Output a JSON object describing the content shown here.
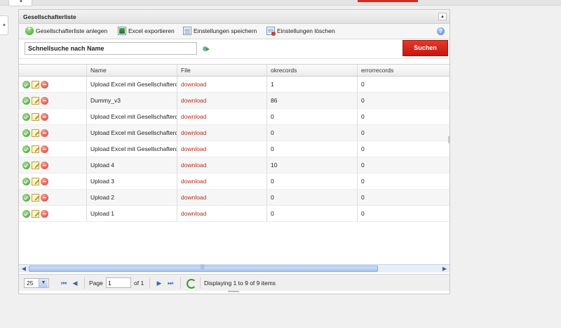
{
  "top": {
    "tab_icon": "plus-icon",
    "left_tab_icon": "plus-icon"
  },
  "panel": {
    "title": "Gesellschafterliste",
    "collapse_glyph": "▲"
  },
  "toolbar": {
    "add_label": "Gesellschafterliste anlegen",
    "export_label": "Excel exportieren",
    "save_label": "Einstellungen speichern",
    "delete_label": "Einstellungen löschen",
    "help_glyph": "?"
  },
  "search": {
    "value": "Schnellsuche nach Name",
    "button_label": "Suchen"
  },
  "grid": {
    "columns": [
      "",
      "Name",
      "File",
      "okrecords",
      "errorrecords"
    ],
    "rows": [
      {
        "name": "Upload Excel mit Gesellschafterdaten",
        "file": "download",
        "ok": "1",
        "err": "0"
      },
      {
        "name": "Dummy_v3",
        "file": "download",
        "ok": "86",
        "err": "0"
      },
      {
        "name": "Upload Excel mit Gesellschafterdaten",
        "file": "download",
        "ok": "0",
        "err": "0"
      },
      {
        "name": "Upload Excel mit Gesellschafterdaten",
        "file": "download",
        "ok": "0",
        "err": "0"
      },
      {
        "name": "Upload Excel mit Gesellschafterdaten",
        "file": "download",
        "ok": "0",
        "err": "0"
      },
      {
        "name": "Upload 4",
        "file": "download",
        "ok": "10",
        "err": "0"
      },
      {
        "name": "Upload 3",
        "file": "download",
        "ok": "0",
        "err": "0"
      },
      {
        "name": "Upload 2",
        "file": "download",
        "ok": "0",
        "err": "0"
      },
      {
        "name": "Upload 1",
        "file": "download",
        "ok": "0",
        "err": "0"
      }
    ]
  },
  "scroll": {
    "left": "◀",
    "right": "▶",
    "grip": "|||"
  },
  "pager": {
    "page_size": "25",
    "size_arrow": "▼",
    "first": "⏮",
    "prev": "◀",
    "page_label": "Page",
    "page_value": "1",
    "of_label": "of 1",
    "next": "▶",
    "last": "⏭",
    "display_text": "Displaying 1 to 9 of 9 items"
  }
}
